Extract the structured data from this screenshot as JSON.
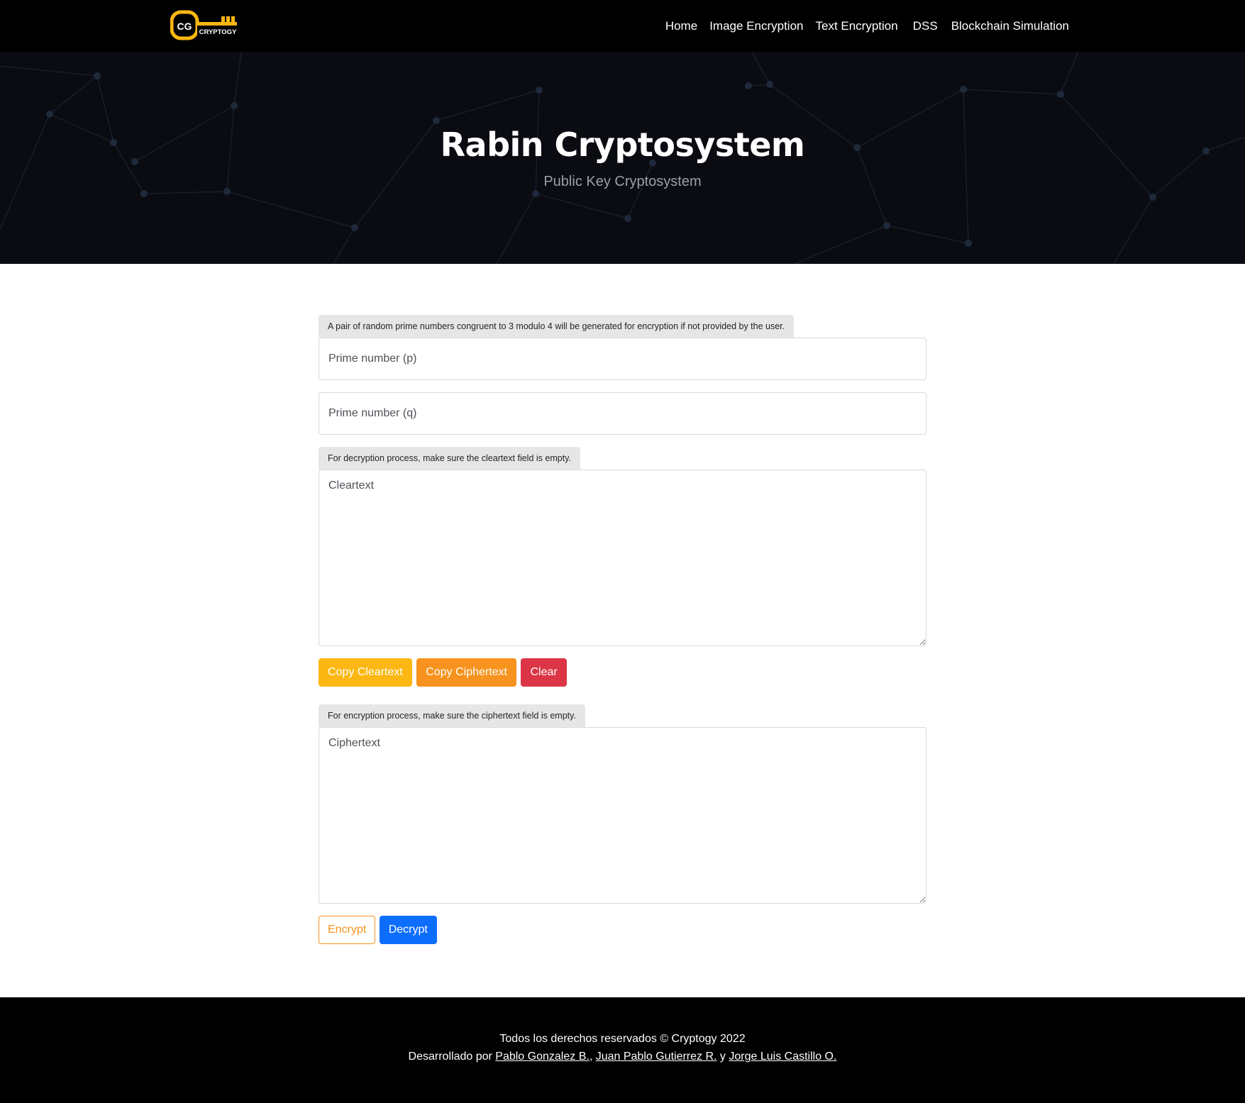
{
  "brand": {
    "logo_text": "CRYPTOGY",
    "accent_color": "#fcb712"
  },
  "nav": {
    "items": [
      {
        "label": "Home"
      },
      {
        "label": "Image Encryption"
      },
      {
        "label": "Text Encryption"
      },
      {
        "label": "DSS"
      },
      {
        "label": "Blockchain Simulation"
      }
    ]
  },
  "hero": {
    "title": "Rabin Cryptosystem",
    "subtitle": "Public Key Cryptosystem"
  },
  "form": {
    "prime_hint": "A pair of random prime numbers congruent to 3 modulo 4 will be generated for encryption if not provided by the user.",
    "p_placeholder": "Prime number (p)",
    "q_placeholder": "Prime number (q)",
    "cleartext_hint": "For decryption process, make sure the cleartext field is empty.",
    "cleartext_placeholder": "Cleartext",
    "copy_cleartext_label": "Copy Cleartext",
    "copy_ciphertext_label": "Copy Ciphertext",
    "clear_label": "Clear",
    "ciphertext_hint": "For encryption process, make sure the ciphertext field is empty.",
    "ciphertext_placeholder": "Ciphertext",
    "encrypt_label": "Encrypt",
    "decrypt_label": "Decrypt"
  },
  "footer": {
    "rights": "Todos los derechos reservados © Cryptogy 2022",
    "dev_prefix": "Desarrollado por",
    "author1": "Pablo Gonzalez B.",
    "sep1": ",",
    "author2": "Juan Pablo Gutierrez R.",
    "sep2": "y",
    "author3": "Jorge Luis Castillo O."
  }
}
